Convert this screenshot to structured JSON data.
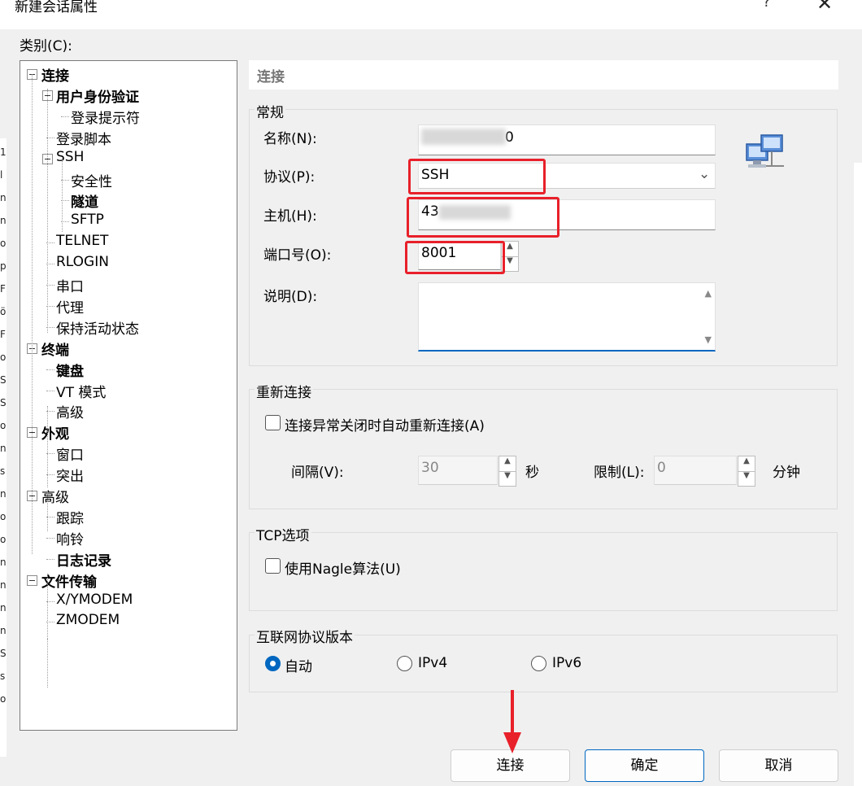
{
  "window": {
    "title": "新建会话属性",
    "help_label": "?",
    "close_label": "✕"
  },
  "left_edge_chars": [
    "1",
    "l",
    "n",
    "n",
    "o",
    "p",
    "F",
    "ö",
    "F",
    "o",
    "S",
    "S",
    "o",
    "n",
    "s",
    "n",
    "o",
    "o",
    "n",
    "n",
    "n",
    "n",
    "S",
    "s",
    "o"
  ],
  "category_label": "类别(C):",
  "tree": [
    {
      "label": "连接",
      "level": 0,
      "bold": true,
      "expander": true
    },
    {
      "label": "用户身份验证",
      "level": 1,
      "bold": true,
      "expander": true
    },
    {
      "label": "登录提示符",
      "level": 2,
      "bold": false,
      "expander": false
    },
    {
      "label": "登录脚本",
      "level": 1,
      "bold": false,
      "expander": false
    },
    {
      "label": "SSH",
      "level": 1,
      "bold": false,
      "expander": true
    },
    {
      "label": "安全性",
      "level": 2,
      "bold": false,
      "expander": false
    },
    {
      "label": "隧道",
      "level": 2,
      "bold": true,
      "expander": false
    },
    {
      "label": "SFTP",
      "level": 2,
      "bold": false,
      "expander": false
    },
    {
      "label": "TELNET",
      "level": 1,
      "bold": false,
      "expander": false
    },
    {
      "label": "RLOGIN",
      "level": 1,
      "bold": false,
      "expander": false
    },
    {
      "label": "串口",
      "level": 1,
      "bold": false,
      "expander": false
    },
    {
      "label": "代理",
      "level": 1,
      "bold": false,
      "expander": false
    },
    {
      "label": "保持活动状态",
      "level": 1,
      "bold": false,
      "expander": false
    },
    {
      "label": "终端",
      "level": 0,
      "bold": true,
      "expander": true
    },
    {
      "label": "键盘",
      "level": 1,
      "bold": true,
      "expander": false
    },
    {
      "label": "VT 模式",
      "level": 1,
      "bold": false,
      "expander": false
    },
    {
      "label": "高级",
      "level": 1,
      "bold": false,
      "expander": false
    },
    {
      "label": "外观",
      "level": 0,
      "bold": true,
      "expander": true
    },
    {
      "label": "窗口",
      "level": 1,
      "bold": false,
      "expander": false
    },
    {
      "label": "突出",
      "level": 1,
      "bold": false,
      "expander": false
    },
    {
      "label": "高级",
      "level": 0,
      "bold": false,
      "expander": true
    },
    {
      "label": "跟踪",
      "level": 1,
      "bold": false,
      "expander": false
    },
    {
      "label": "响铃",
      "level": 1,
      "bold": false,
      "expander": false
    },
    {
      "label": "日志记录",
      "level": 1,
      "bold": true,
      "expander": false
    },
    {
      "label": "文件传输",
      "level": 0,
      "bold": true,
      "expander": true
    },
    {
      "label": "X/YMODEM",
      "level": 1,
      "bold": false,
      "expander": false
    },
    {
      "label": "ZMODEM",
      "level": 1,
      "bold": false,
      "expander": false
    }
  ],
  "panel": {
    "header": "连接",
    "general": {
      "title": "常规",
      "name_label": "名称(N):",
      "name_value_visible": "0",
      "protocol_label": "协议(P):",
      "protocol_value": "SSH",
      "host_label": "主机(H):",
      "host_value_visible": "43",
      "port_label": "端口号(O):",
      "port_value": "8001",
      "desc_label": "说明(D):",
      "desc_value": ""
    },
    "reconnect": {
      "title": "重新连接",
      "auto_label": "连接异常关闭时自动重新连接(A)",
      "auto_checked": false,
      "interval_label": "间隔(V):",
      "interval_value": "30",
      "interval_unit": "秒",
      "limit_label": "限制(L):",
      "limit_value": "0",
      "limit_unit": "分钟"
    },
    "tcp": {
      "title": "TCP选项",
      "nagle_label": "使用Nagle算法(U)",
      "nagle_checked": false
    },
    "ip": {
      "title": "互联网协议版本",
      "options": [
        "自动",
        "IPv4",
        "IPv6"
      ],
      "selected": "自动"
    }
  },
  "buttons": {
    "connect": "连接",
    "ok": "确定",
    "cancel": "取消"
  },
  "colors": {
    "highlight": "#e8202a",
    "accent": "#0067c0"
  }
}
